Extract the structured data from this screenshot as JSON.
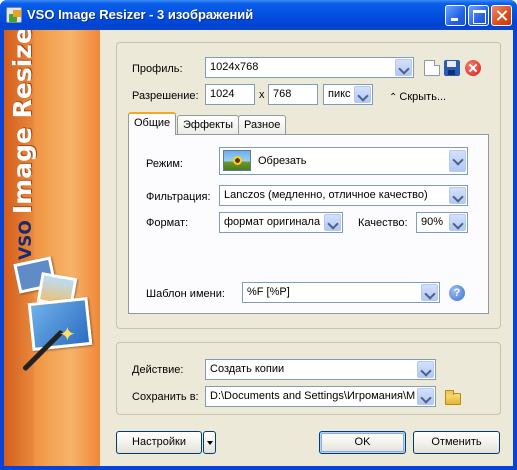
{
  "window": {
    "title": "VSO Image Resizer - 3 изображений"
  },
  "banner": {
    "brand": "VSO",
    "product": "Image Resizer"
  },
  "profile": {
    "label": "Профиль:",
    "value": "1024x768"
  },
  "resolution": {
    "label": "Разрешение:",
    "width": "1024",
    "separator": "x",
    "height": "768",
    "unit": "пикс",
    "collapse_label": "Скрыть..."
  },
  "tabs": [
    {
      "label": "Общие",
      "active": true
    },
    {
      "label": "Эффекты",
      "active": false
    },
    {
      "label": "Разное",
      "active": false
    }
  ],
  "general": {
    "mode_label": "Режим:",
    "mode_value": "Обрезать",
    "filter_label": "Фильтрация:",
    "filter_value": "Lanczos (медленно, отличное качество)",
    "format_label": "Формат:",
    "format_value": "формат оригинала",
    "quality_label": "Качество:",
    "quality_value": "90%",
    "template_label": "Шаблон имени:",
    "template_value": "%F [%P]"
  },
  "output": {
    "action_label": "Действие:",
    "action_value": "Создать копии",
    "save_label": "Сохранить в:",
    "save_value": "D:\\Documents and Settings\\Игромания\\Мо"
  },
  "buttons": {
    "settings": "Настройки",
    "ok": "OK",
    "cancel": "Отменить"
  },
  "icons": [
    "new-profile-icon",
    "save-profile-icon",
    "delete-profile-icon",
    "help-icon",
    "folder-icon"
  ],
  "colors": {
    "titlebar": "#0a5ee8",
    "dialog": "#ece9d8",
    "banner": "#f3a14f",
    "tab_accent": "#f5a623"
  }
}
